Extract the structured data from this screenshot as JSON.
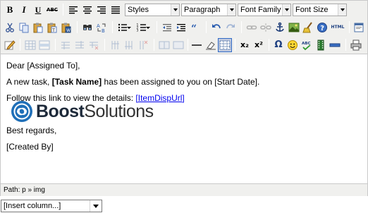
{
  "toolbar1": {
    "bold": "B",
    "italic": "I",
    "underline": "U",
    "strike": "ABC",
    "styles": "Styles",
    "paragraph": "Paragraph",
    "font_family": "Font Family",
    "font_size": "Font Size"
  },
  "toolbar2": {
    "html_label": "HTML",
    "icons": [
      "cut-icon",
      "copy-icon",
      "paste-icon",
      "paste-text-icon",
      "paste-word-icon",
      "find-icon",
      "replace-icon",
      "bullet-list-icon",
      "numbered-list-icon",
      "outdent-icon",
      "indent-icon",
      "blockquote-icon",
      "undo-icon",
      "redo-icon",
      "link-icon",
      "unlink-icon",
      "anchor-icon",
      "image-icon",
      "cleanup-icon",
      "help-icon",
      "html-source-icon",
      "preview-icon"
    ]
  },
  "toolbar3": {
    "subscript": "x₂",
    "superscript": "x²",
    "omega": "Ω",
    "icons": [
      "edit-icon",
      "table-icon",
      "row-props-icon",
      "cell-props-icon",
      "insert-row-before-icon",
      "insert-row-after-icon",
      "delete-row-icon",
      "insert-col-before-icon",
      "insert-col-after-icon",
      "delete-col-icon",
      "split-cells-icon",
      "merge-cells-icon",
      "horizontal-rule-icon",
      "remove-format-icon",
      "visual-aid-icon",
      "subscript-icon",
      "superscript-icon",
      "special-char-icon",
      "emoticons-icon",
      "spellcheck-icon",
      "media-icon",
      "advanced-hr-icon",
      "print-icon"
    ]
  },
  "content": {
    "greeting": "Dear [Assigned To],",
    "line2_prefix": "A new task, ",
    "task_name": "[Task Name]",
    "line2_suffix": " has been assigned to you on [Start Date].",
    "line3_prefix": "Follow this link to view the details: ",
    "link_text": "[ItemDispUrl]",
    "regards": "Best regards,",
    "created_by": "[Created By]",
    "logo_boost": "Boost",
    "logo_solutions": "Solutions"
  },
  "statusbar": {
    "path": "Path: p » img"
  },
  "insert_column": {
    "selected": "[Insert column...]"
  },
  "colors": {
    "toolbar_bg": "#f0f0ee",
    "border": "#c9c9c9",
    "link": "#0000ee",
    "logo_blue": "#1f6fb8"
  }
}
